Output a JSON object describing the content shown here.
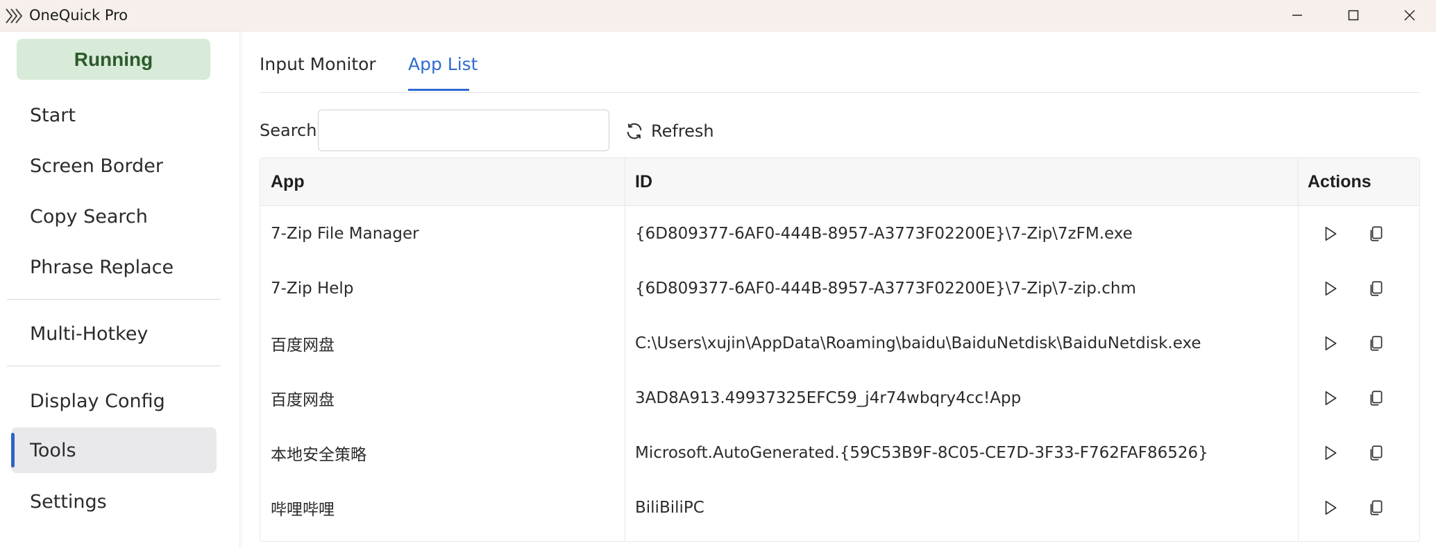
{
  "window": {
    "title": "OneQuick Pro"
  },
  "sidebar": {
    "status": "Running",
    "items": [
      {
        "label": "Start"
      },
      {
        "label": "Screen Border"
      },
      {
        "label": "Copy Search"
      },
      {
        "label": "Phrase Replace"
      },
      {
        "label": "Multi-Hotkey"
      },
      {
        "label": "Display Config"
      },
      {
        "label": "Tools"
      },
      {
        "label": "Settings"
      }
    ],
    "active_item": "Tools"
  },
  "tabs": [
    {
      "label": "Input Monitor"
    },
    {
      "label": "App List"
    }
  ],
  "active_tab": "App List",
  "search": {
    "label": "Search:",
    "value": "",
    "placeholder": ""
  },
  "refresh_label": "Refresh",
  "table": {
    "headers": {
      "app": "App",
      "id": "ID",
      "actions": "Actions"
    },
    "rows": [
      {
        "app": "7-Zip File Manager",
        "id": "{6D809377-6AF0-444B-8957-A3773F02200E}\\7-Zip\\7zFM.exe"
      },
      {
        "app": "7-Zip Help",
        "id": "{6D809377-6AF0-444B-8957-A3773F02200E}\\7-Zip\\7-zip.chm"
      },
      {
        "app": "百度网盘",
        "id": "C:\\Users\\xujin\\AppData\\Roaming\\baidu\\BaiduNetdisk\\BaiduNetdisk.exe"
      },
      {
        "app": "百度网盘",
        "id": "3AD8A913.49937325EFC59_j4r74wbqry4cc!App"
      },
      {
        "app": "本地安全策略",
        "id": "Microsoft.AutoGenerated.{59C53B9F-8C05-CE7D-3F33-F762FAF86526}"
      },
      {
        "app": "哔哩哔哩",
        "id": "BiliBiliPC"
      }
    ]
  },
  "colors": {
    "accent": "#2f6bd0",
    "status_bg": "#d8ead8",
    "status_text": "#2c5a2c",
    "titlebar_bg": "#f6efec"
  }
}
